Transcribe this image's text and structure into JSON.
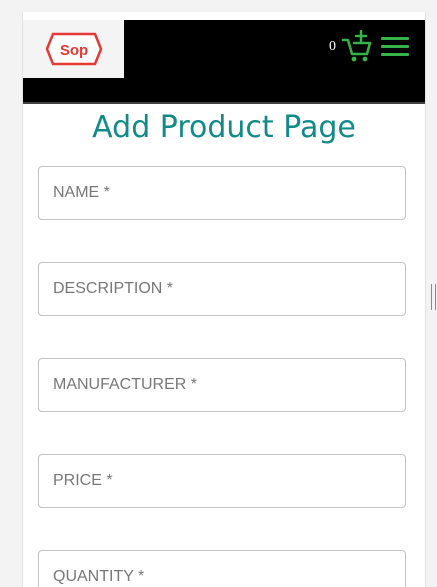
{
  "header": {
    "logo_text": "Sop",
    "cart_count": "0"
  },
  "page": {
    "title": "Add Product Page"
  },
  "form": {
    "fields": [
      {
        "placeholder": "NAME *",
        "value": ""
      },
      {
        "placeholder": "DESCRIPTION *",
        "value": ""
      },
      {
        "placeholder": "MANUFACTURER *",
        "value": ""
      },
      {
        "placeholder": "PRICE *",
        "value": ""
      },
      {
        "placeholder": "QUANTITY *",
        "value": ""
      }
    ]
  },
  "colors": {
    "navbar": "#000000",
    "accent_green": "#35b24a",
    "title": "#138a8a",
    "logo_red": "#e53935"
  },
  "icons": [
    "shop-logo",
    "add-to-cart-icon",
    "hamburger-menu-icon"
  ]
}
